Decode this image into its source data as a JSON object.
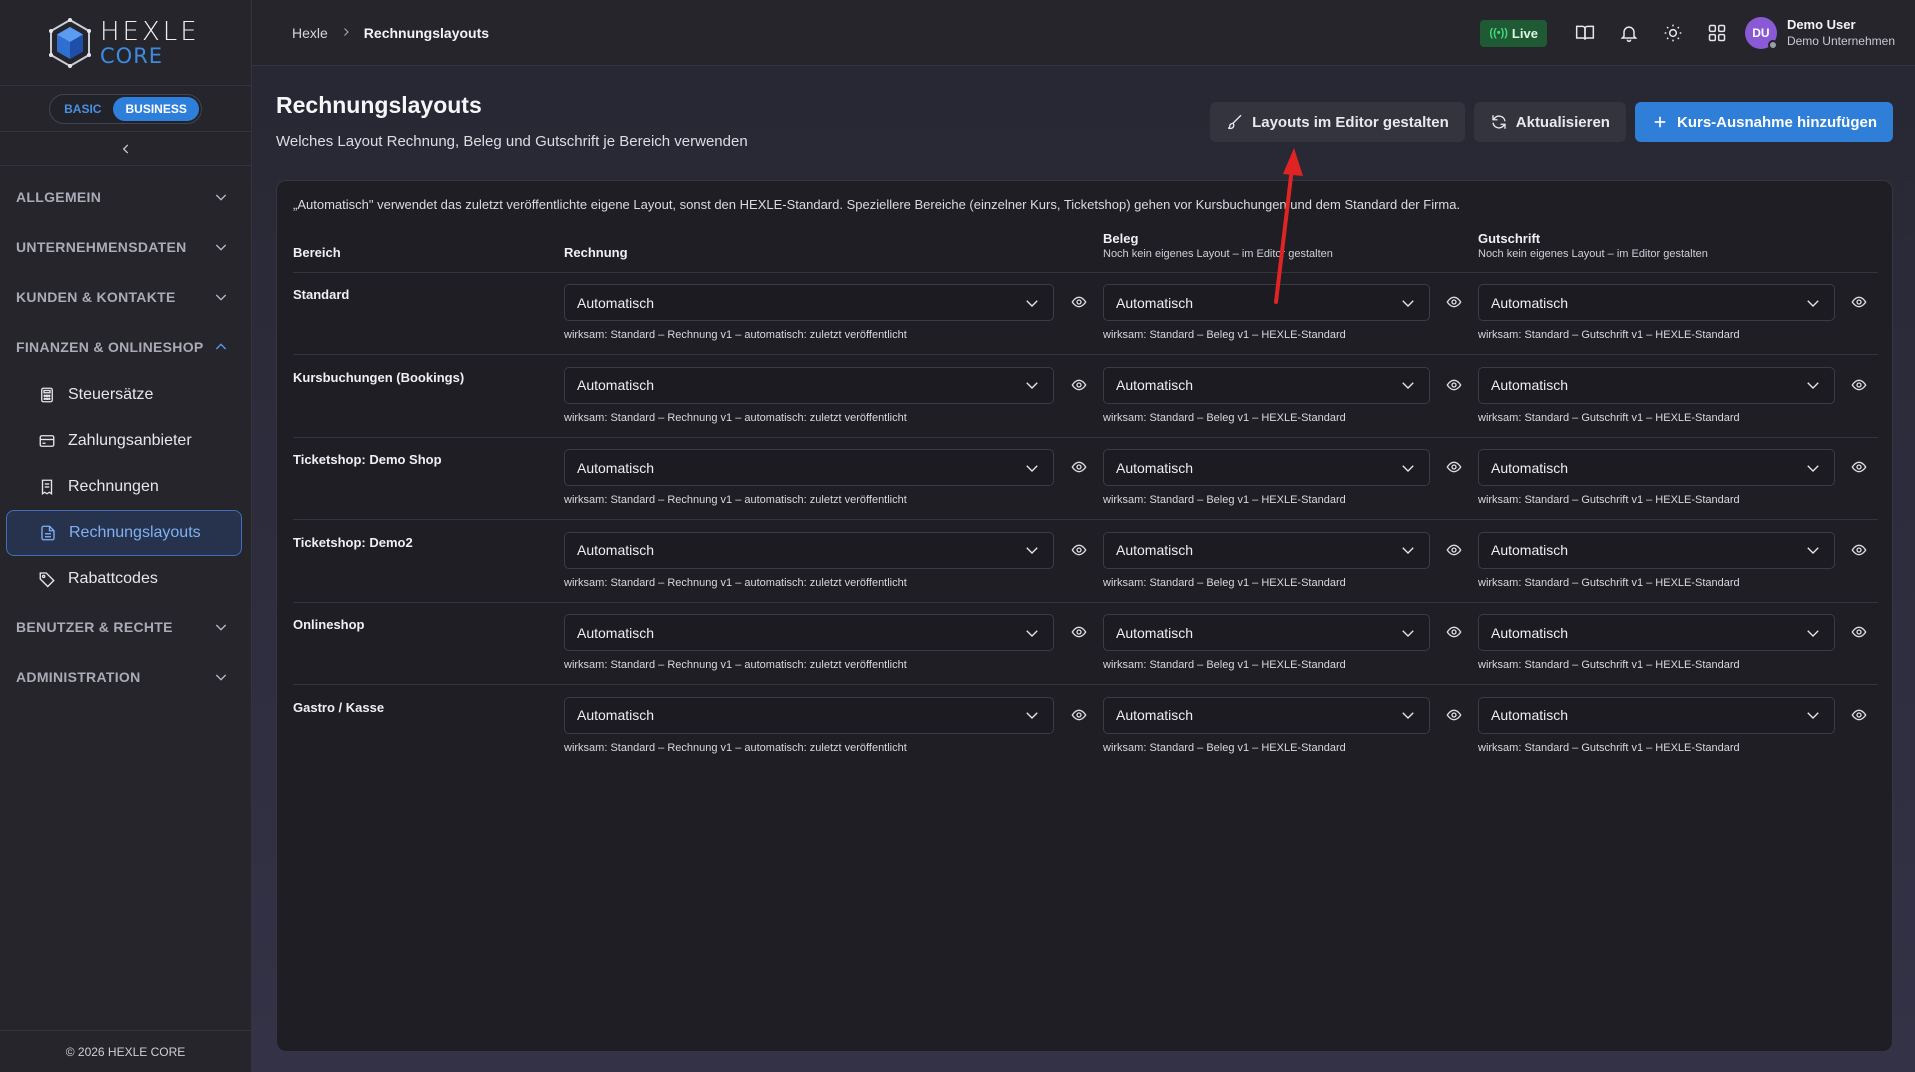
{
  "brand": {
    "line1": "HEXLE",
    "line2": "CORE"
  },
  "plan": {
    "basic": "BASIC",
    "business": "BUSINESS"
  },
  "nav": {
    "sections": {
      "allgemein": "ALLGEMEIN",
      "unternehmensdaten": "UNTERNEHMENSDATEN",
      "kunden": "KUNDEN & KONTAKTE",
      "finanzen": "FINANZEN & ONLINESHOP",
      "benutzer": "BENUTZER & RECHTE",
      "administration": "ADMINISTRATION"
    },
    "items": {
      "steuersaetze": "Steuersätze",
      "zahlungsanbieter": "Zahlungsanbieter",
      "rechnungen": "Rechnungen",
      "rechnungslayouts": "Rechnungslayouts",
      "rabattcodes": "Rabattcodes"
    }
  },
  "footer": "© 2026 HEXLE CORE",
  "breadcrumb": {
    "home": "Hexle",
    "current": "Rechnungslayouts"
  },
  "topbar": {
    "live": "Live",
    "avatar_initials": "DU",
    "user_name": "Demo User",
    "company": "Demo Unternehmen"
  },
  "page": {
    "title": "Rechnungslayouts",
    "subtitle": "Welches Layout Rechnung, Beleg und Gutschrift je Bereich verwenden"
  },
  "actions": {
    "editor": "Layouts im Editor gestalten",
    "refresh": "Aktualisieren",
    "add": "Kurs-Ausnahme hinzufügen"
  },
  "info": "„Automatisch\" verwendet das zuletzt veröffentlichte eigene Layout, sonst den HEXLE-Standard. Speziellere Bereiche (einzelner Kurs, Ticketshop) gehen vor Kursbuchungen und dem Standard der Firma.",
  "table": {
    "headers": {
      "bereich": "Bereich",
      "rechnung": "Rechnung",
      "beleg": "Beleg",
      "beleg_hint": "Noch kein eigenes Layout – im Editor gestalten",
      "gutschrift": "Gutschrift",
      "gutschrift_hint": "Noch kein eigenes Layout – im Editor gestalten"
    },
    "rows": [
      {
        "area": "Standard",
        "rechnung": "Automatisch",
        "beleg": "Automatisch",
        "gutschrift": "Automatisch",
        "rechnung_eff": "wirksam: Standard – Rechnung v1 – automatisch: zuletzt veröffentlicht",
        "beleg_eff": "wirksam: Standard – Beleg v1 – HEXLE-Standard",
        "gutschrift_eff": "wirksam: Standard – Gutschrift v1 – HEXLE-Standard"
      },
      {
        "area": "Kursbuchungen (Bookings)",
        "rechnung": "Automatisch",
        "beleg": "Automatisch",
        "gutschrift": "Automatisch",
        "rechnung_eff": "wirksam: Standard – Rechnung v1 – automatisch: zuletzt veröffentlicht",
        "beleg_eff": "wirksam: Standard – Beleg v1 – HEXLE-Standard",
        "gutschrift_eff": "wirksam: Standard – Gutschrift v1 – HEXLE-Standard"
      },
      {
        "area": "Ticketshop: Demo Shop",
        "rechnung": "Automatisch",
        "beleg": "Automatisch",
        "gutschrift": "Automatisch",
        "rechnung_eff": "wirksam: Standard – Rechnung v1 – automatisch: zuletzt veröffentlicht",
        "beleg_eff": "wirksam: Standard – Beleg v1 – HEXLE-Standard",
        "gutschrift_eff": "wirksam: Standard – Gutschrift v1 – HEXLE-Standard"
      },
      {
        "area": "Ticketshop: Demo2",
        "rechnung": "Automatisch",
        "beleg": "Automatisch",
        "gutschrift": "Automatisch",
        "rechnung_eff": "wirksam: Standard – Rechnung v1 – automatisch: zuletzt veröffentlicht",
        "beleg_eff": "wirksam: Standard – Beleg v1 – HEXLE-Standard",
        "gutschrift_eff": "wirksam: Standard – Gutschrift v1 – HEXLE-Standard"
      },
      {
        "area": "Onlineshop",
        "rechnung": "Automatisch",
        "beleg": "Automatisch",
        "gutschrift": "Automatisch",
        "rechnung_eff": "wirksam: Standard – Rechnung v1 – automatisch: zuletzt veröffentlicht",
        "beleg_eff": "wirksam: Standard – Beleg v1 – HEXLE-Standard",
        "gutschrift_eff": "wirksam: Standard – Gutschrift v1 – HEXLE-Standard"
      },
      {
        "area": "Gastro / Kasse",
        "rechnung": "Automatisch",
        "beleg": "Automatisch",
        "gutschrift": "Automatisch",
        "rechnung_eff": "wirksam: Standard – Rechnung v1 – automatisch: zuletzt veröffentlicht",
        "beleg_eff": "wirksam: Standard – Beleg v1 – HEXLE-Standard",
        "gutschrift_eff": "wirksam: Standard – Gutschrift v1 – HEXLE-Standard"
      }
    ]
  },
  "colors": {
    "accent": "#2f7fd9",
    "live": "#1f5a34",
    "annotation": "#e02424"
  }
}
